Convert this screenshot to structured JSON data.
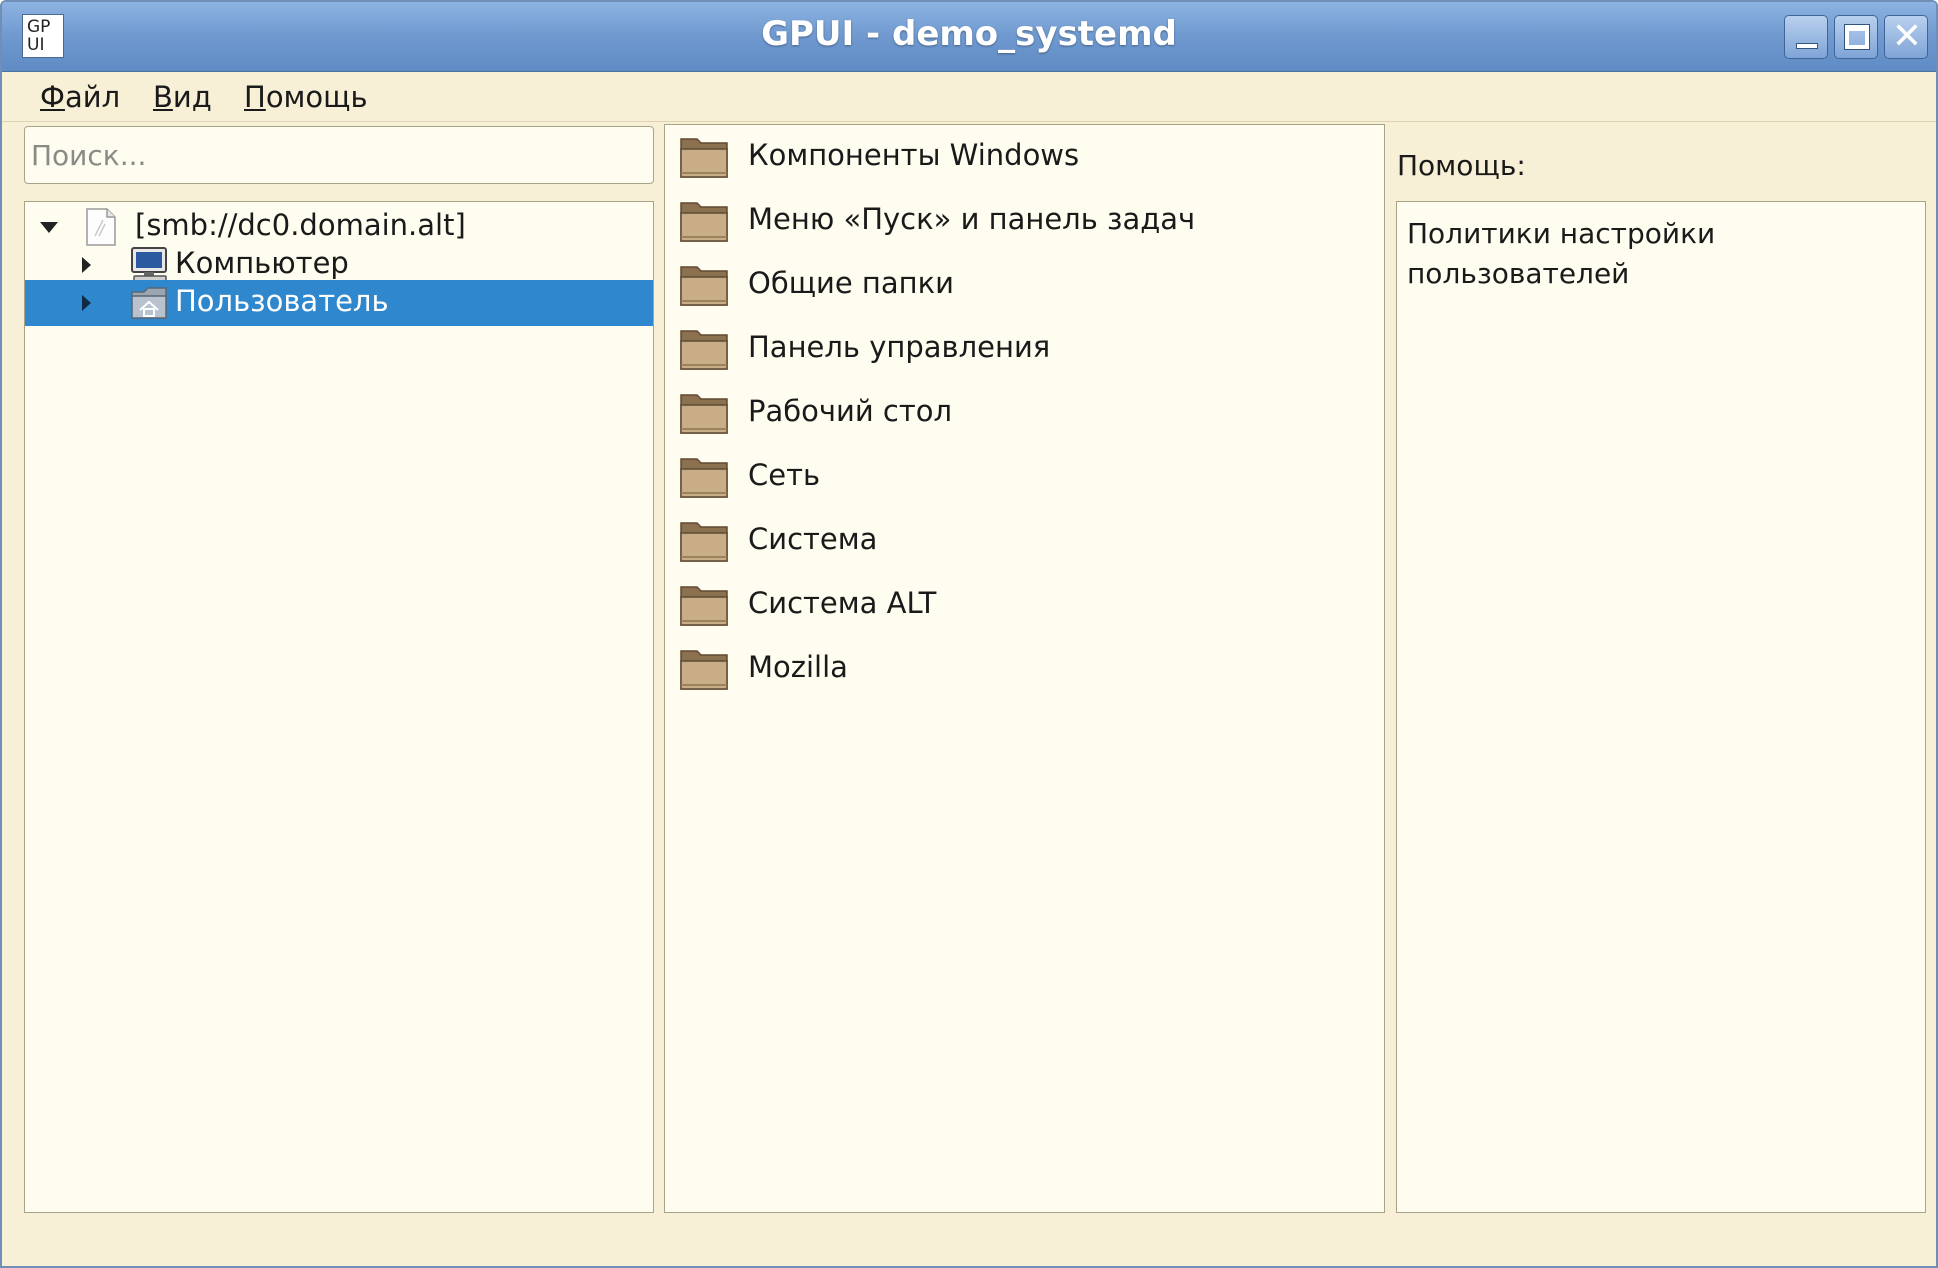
{
  "window": {
    "title": "GPUI - demo_systemd",
    "icon_text": "GP\nUI",
    "controls": [
      "minimize-icon",
      "maximize-icon",
      "close-icon"
    ]
  },
  "menu": {
    "file": {
      "accel": "Ф",
      "rest": "айл"
    },
    "view": {
      "accel": "В",
      "rest": "ид"
    },
    "help": {
      "accel": "П",
      "rest": "омощь"
    }
  },
  "search": {
    "placeholder": "Поиск..."
  },
  "tree": {
    "root": {
      "label": "[smb://dc0.domain.alt]",
      "icon": "document-icon",
      "expanded": true
    },
    "children": [
      {
        "label": "Компьютер",
        "icon": "computer-icon",
        "expanded": false,
        "selected": false
      },
      {
        "label": "Пользователь",
        "icon": "user-home-icon",
        "expanded": false,
        "selected": true
      }
    ]
  },
  "list": {
    "items": [
      {
        "label": "Компоненты Windows",
        "icon": "folder-icon"
      },
      {
        "label": "Меню «Пуск» и панель задач",
        "icon": "folder-icon"
      },
      {
        "label": "Общие папки",
        "icon": "folder-icon"
      },
      {
        "label": "Панель управления",
        "icon": "folder-icon"
      },
      {
        "label": "Рабочий стол",
        "icon": "folder-icon"
      },
      {
        "label": "Сеть",
        "icon": "folder-icon"
      },
      {
        "label": "Система",
        "icon": "folder-icon"
      },
      {
        "label": "Система ALT",
        "icon": "folder-icon"
      },
      {
        "label": "Mozilla",
        "icon": "folder-icon"
      }
    ]
  },
  "help": {
    "title": "Помощь:",
    "text": "Политики настройки\nпользователей"
  },
  "colors": {
    "titlebar": "#6f99cf",
    "window_bg": "#f7f0d7",
    "panel_bg": "#fffdf0",
    "selection": "#2f87cd"
  }
}
